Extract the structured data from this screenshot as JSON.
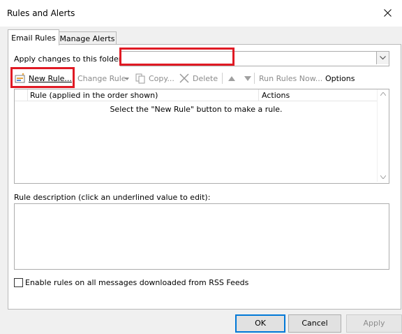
{
  "window": {
    "title": "Rules and Alerts"
  },
  "tabs": [
    {
      "label": "Email Rules",
      "active": true
    },
    {
      "label": "Manage Alerts",
      "active": false
    }
  ],
  "folder": {
    "label": "Apply changes to this folder:",
    "value": ""
  },
  "toolbar": {
    "new_rule": "New Rule...",
    "change_rule": "Change Rule",
    "copy": "Copy...",
    "delete": "Delete",
    "run_rules_now": "Run Rules Now...",
    "options": "Options"
  },
  "rules_list": {
    "columns": [
      "Rule (applied in the order shown)",
      "Actions"
    ],
    "empty_message": "Select the \"New Rule\" button to make a rule.",
    "rows": []
  },
  "description": {
    "label": "Rule description (click an underlined value to edit):",
    "text": ""
  },
  "rss_option": {
    "label": "Enable rules on all messages downloaded from RSS Feeds",
    "checked": false
  },
  "buttons": {
    "ok": "OK",
    "cancel": "Cancel",
    "apply": "Apply"
  },
  "colors": {
    "highlight": "#e01a24",
    "accent": "#0078d7"
  }
}
